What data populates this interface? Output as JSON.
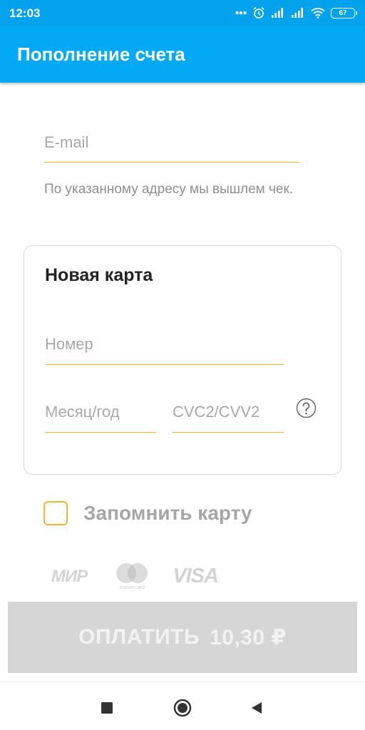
{
  "status_bar": {
    "time": "12:03",
    "battery_level": "67",
    "icons": [
      "more-dots-icon",
      "alarm-icon",
      "signal-icon",
      "signal-icon",
      "wifi-icon",
      "battery-icon"
    ]
  },
  "app_bar": {
    "title": "Пополнение счета",
    "color": "#03a9f4"
  },
  "form": {
    "email": {
      "placeholder": "E-mail",
      "value": ""
    },
    "email_hint": "По указанному адресу мы вышлем чек.",
    "card": {
      "title": "Новая карта",
      "number": {
        "placeholder": "Номер",
        "value": ""
      },
      "expiry": {
        "placeholder": "Месяц/год",
        "value": ""
      },
      "cvc": {
        "placeholder": "CVC2/CVV2",
        "value": ""
      },
      "help_icon": "question-circle-icon"
    },
    "remember_card": {
      "label": "Запомнить карту",
      "checked": false
    }
  },
  "payment_logos": {
    "mir": "МИР",
    "mastercard": "mastercard",
    "visa": "VISA"
  },
  "pay_button": {
    "label": "ОПЛАТИТЬ",
    "amount": "10,30 ₽"
  },
  "nav_bar": {
    "buttons": [
      "recents-square-icon",
      "home-circle-icon",
      "back-triangle-icon"
    ]
  },
  "colors": {
    "accent": "#f5b52c",
    "primary": "#03a9f4",
    "disabled_button": "#d6d6d6"
  }
}
